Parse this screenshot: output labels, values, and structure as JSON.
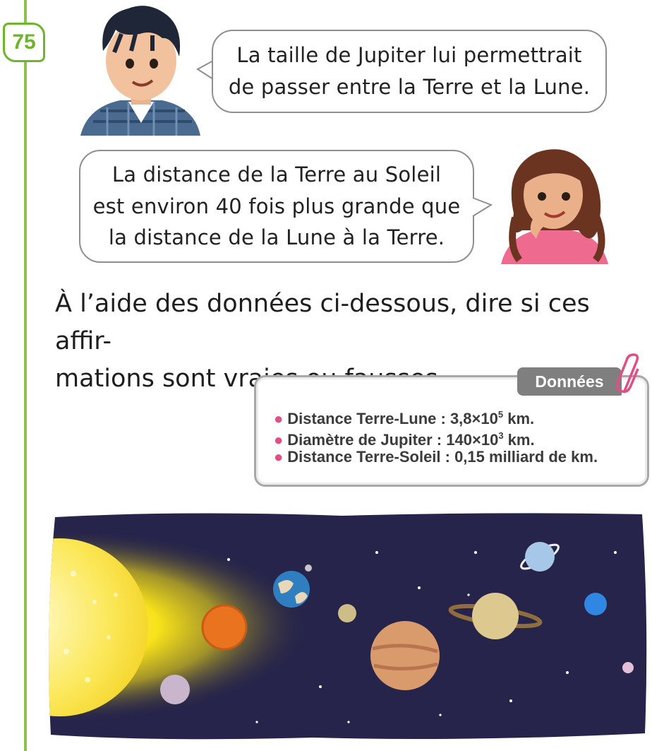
{
  "exercise": {
    "number": "75"
  },
  "dialogue": [
    {
      "speaker": "boy",
      "lines": [
        "La taille de Jupiter lui permettrait",
        "de passer entre la Terre et la Lune."
      ]
    },
    {
      "speaker": "girl",
      "lines": [
        "La distance de la Terre au Soleil",
        "est environ 40 fois plus grande que",
        "la distance de la Lune à la Terre."
      ]
    }
  ],
  "question": {
    "lines": [
      "À l’aide des données ci-dessous, dire si ces affir-",
      "mations sont vraies ou fausses."
    ]
  },
  "data_box": {
    "title": "Données",
    "items": [
      {
        "label": "Distance Terre-Lune : 3,8",
        "times": "×",
        "base": "10",
        "exp": "5",
        "unit": " km."
      },
      {
        "label": "Diamètre de Jupiter : 140",
        "times": "×",
        "base": "10",
        "exp": "3",
        "unit": " km."
      },
      {
        "label": "Distance Terre-Soleil : 0,15 milliard de km."
      }
    ]
  },
  "colors": {
    "accent_green": "#6fb52c",
    "bullet_pink": "#e24d86",
    "tag_grey": "#7f7f7f",
    "space_navy": "#26244a"
  },
  "illustration": {
    "icon": "solar-system-illustration"
  }
}
